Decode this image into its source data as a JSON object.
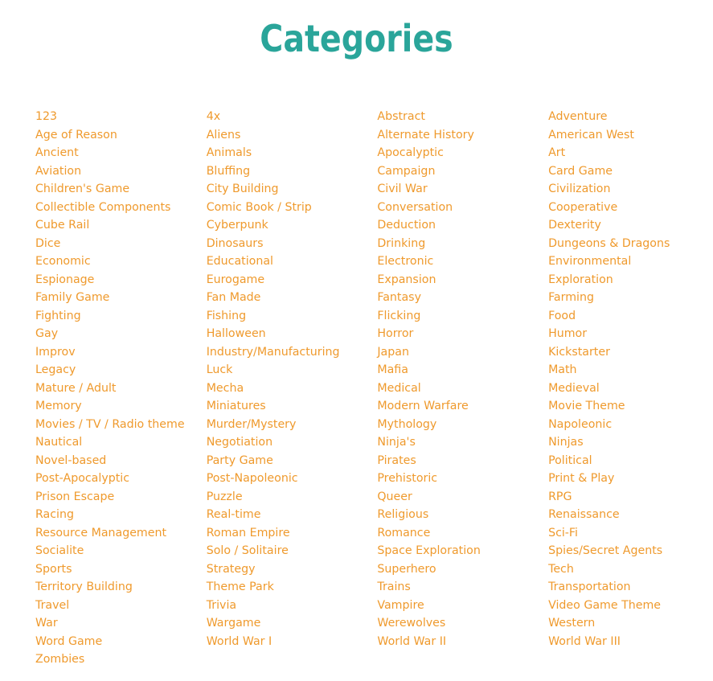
{
  "page": {
    "title": "Categories"
  },
  "colors": {
    "title": "#2aa59a",
    "link": "#ef9a2d",
    "background": "#ffffff"
  },
  "columns": [
    [
      "123",
      "Age of Reason",
      "Ancient",
      "Aviation",
      "Children's Game",
      "Collectible Components",
      "Cube Rail",
      "Dice",
      "Economic",
      "Espionage",
      "Family Game",
      "Fighting",
      "Gay",
      "Improv",
      "Legacy",
      "Mature / Adult",
      "Memory",
      "Movies / TV / Radio theme",
      "Nautical",
      "Novel-based",
      "Post-Apocalyptic",
      "Prison Escape",
      "Racing",
      "Resource Management",
      "Socialite",
      "Sports",
      "Territory Building",
      "Travel",
      "War",
      "Word Game",
      "Zombies"
    ],
    [
      "4x",
      "Aliens",
      "Animals",
      "Bluffing",
      "City Building",
      "Comic Book / Strip",
      "Cyberpunk",
      "Dinosaurs",
      "Educational",
      "Eurogame",
      "Fan Made",
      "Fishing",
      "Halloween",
      "Industry/Manufacturing",
      "Luck",
      "Mecha",
      "Miniatures",
      "Murder/Mystery",
      "Negotiation",
      "Party Game",
      "Post-Napoleonic",
      "Puzzle",
      "Real-time",
      "Roman Empire",
      "Solo / Solitaire",
      "Strategy",
      "Theme Park",
      "Trivia",
      "Wargame",
      "World War I"
    ],
    [
      "Abstract",
      "Alternate History",
      "Apocalyptic",
      "Campaign",
      "Civil War",
      "Conversation",
      "Deduction",
      "Drinking",
      "Electronic",
      "Expansion",
      "Fantasy",
      "Flicking",
      "Horror",
      "Japan",
      "Mafia",
      "Medical",
      "Modern Warfare",
      "Mythology",
      "Ninja's",
      "Pirates",
      "Prehistoric",
      "Queer",
      "Religious",
      "Romance",
      "Space Exploration",
      "Superhero",
      "Trains",
      "Vampire",
      "Werewolves",
      "World War II"
    ],
    [
      "Adventure",
      "American West",
      "Art",
      "Card Game",
      "Civilization",
      "Cooperative",
      "Dexterity",
      "Dungeons & Dragons",
      "Environmental",
      "Exploration",
      "Farming",
      "Food",
      "Humor",
      "Kickstarter",
      "Math",
      "Medieval",
      "Movie Theme",
      "Napoleonic",
      "Ninjas",
      "Political",
      "Print & Play",
      "RPG",
      "Renaissance",
      "Sci-Fi",
      "Spies/Secret Agents",
      "Tech",
      "Transportation",
      "Video Game Theme",
      "Western",
      "World War III"
    ]
  ]
}
